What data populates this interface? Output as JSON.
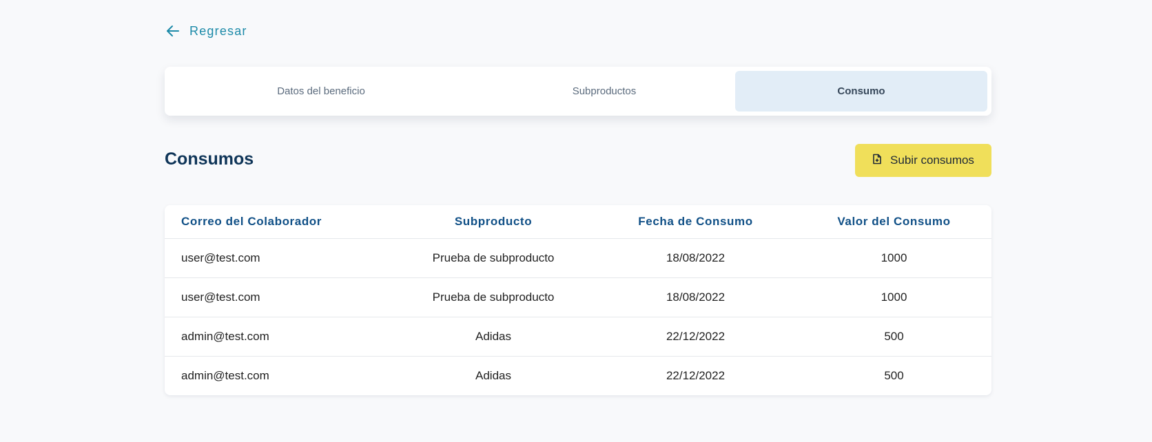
{
  "back": {
    "label": "Regresar"
  },
  "tabs": [
    {
      "label": "Datos del beneficio"
    },
    {
      "label": "Subproductos"
    },
    {
      "label": "Consumo"
    }
  ],
  "section": {
    "title": "Consumos"
  },
  "upload_button": {
    "label": "Subir consumos"
  },
  "table": {
    "columns": [
      "Correo del Colaborador",
      "Subproducto",
      "Fecha de Consumo",
      "Valor del Consumo"
    ],
    "rows": [
      [
        "user@test.com",
        "Prueba de subproducto",
        "18/08/2022",
        "1000"
      ],
      [
        "user@test.com",
        "Prueba de subproducto",
        "18/08/2022",
        "1000"
      ],
      [
        "admin@test.com",
        "Adidas",
        "22/12/2022",
        "500"
      ],
      [
        "admin@test.com",
        "Adidas",
        "22/12/2022",
        "500"
      ]
    ]
  },
  "colors": {
    "accent": "#1c8aa8",
    "heading": "#0f3558",
    "table_header": "#0f4f86",
    "active_tab_bg": "#e2edf7",
    "button_bg": "#f0df5a"
  },
  "icons": {
    "back": "arrow-left-icon",
    "upload": "file-plus-icon"
  }
}
